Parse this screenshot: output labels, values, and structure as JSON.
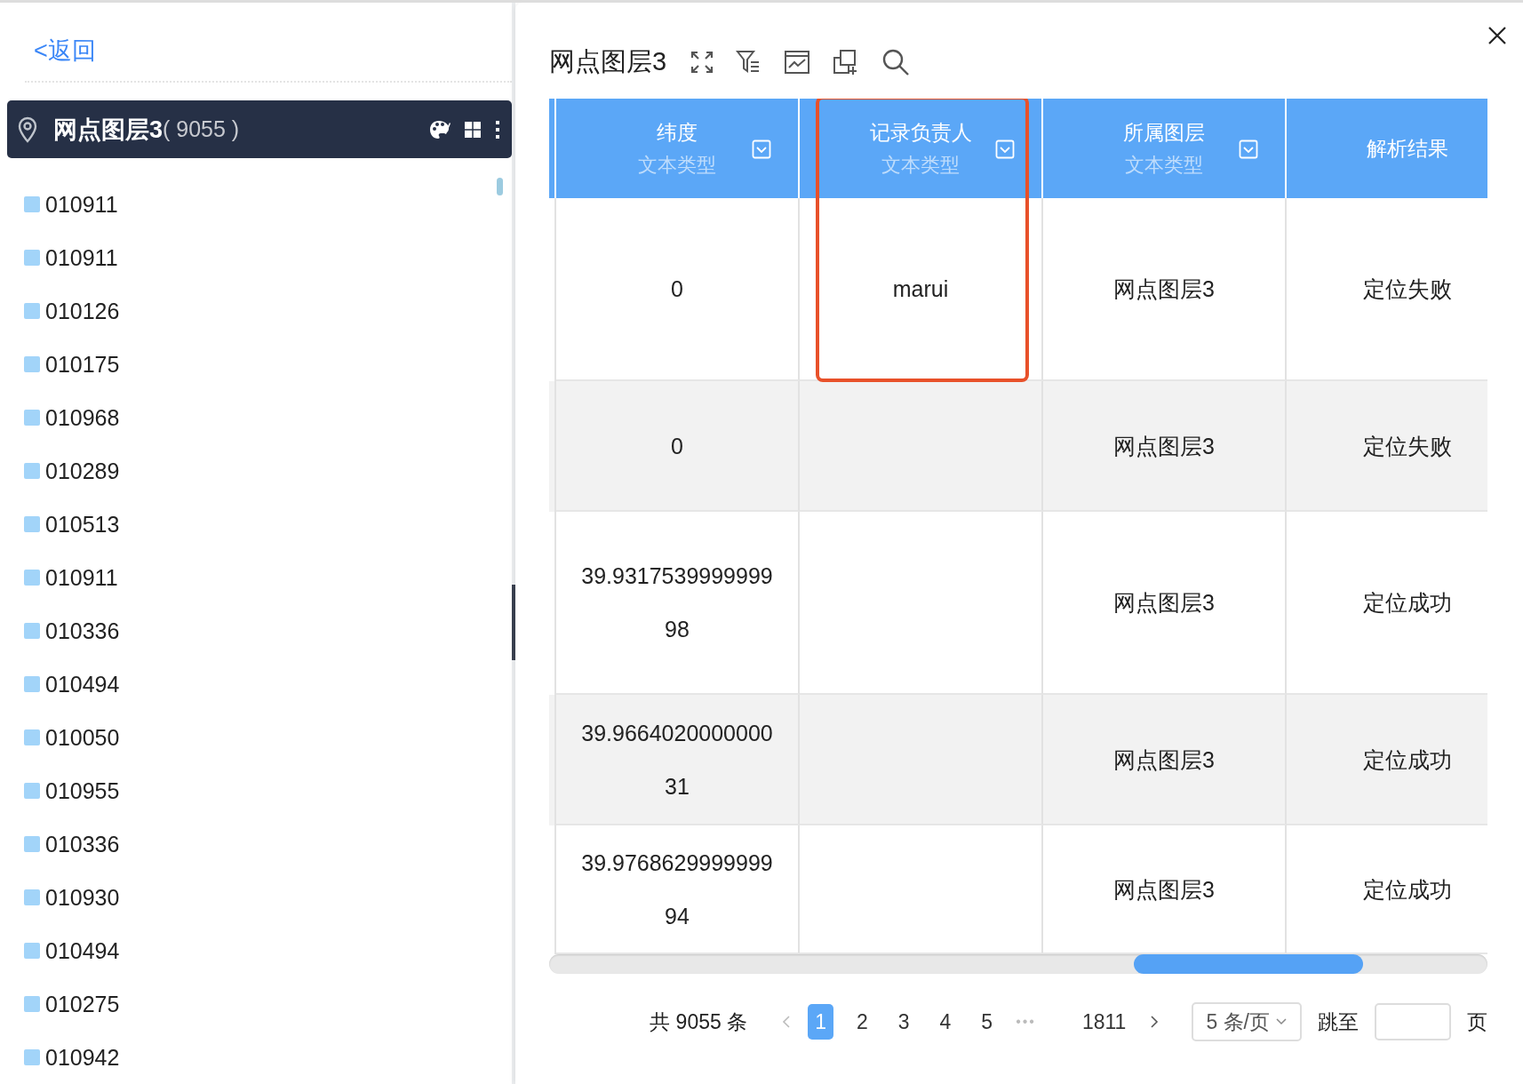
{
  "back_link": "<返回",
  "layer": {
    "name": "网点图层3",
    "count": "( 9055 )"
  },
  "items": [
    "010911",
    "010911",
    "010126",
    "010175",
    "010968",
    "010289",
    "010513",
    "010911",
    "010336",
    "010494",
    "010050",
    "010955",
    "010336",
    "010930",
    "010494",
    "010275",
    "010942"
  ],
  "panel": {
    "title": "网点图层3"
  },
  "columns": [
    {
      "title": "纬度",
      "type": "文本类型",
      "highlighted": false
    },
    {
      "title": "记录负责人",
      "type": "文本类型",
      "highlighted": true
    },
    {
      "title": "所属图层",
      "type": "文本类型",
      "highlighted": false
    },
    {
      "title": "解析结果",
      "highlighted": false
    }
  ],
  "rows": [
    [
      "0",
      "marui",
      "网点图层3",
      "定位失败"
    ],
    [
      "0",
      "",
      "网点图层3",
      "定位失败"
    ],
    [
      "39.931753999999998",
      "",
      "网点图层3",
      "定位成功"
    ],
    [
      "39.966402000000031",
      "",
      "网点图层3",
      "定位成功"
    ],
    [
      "39.976862999999994",
      "",
      "网点图层3",
      "定位成功"
    ]
  ],
  "pagination": {
    "total": "共 9055 条",
    "pages": [
      {
        "label": "1",
        "selected": true
      },
      {
        "label": "2",
        "selected": false
      },
      {
        "label": "3",
        "selected": false
      },
      {
        "label": "4",
        "selected": false
      },
      {
        "label": "5",
        "selected": false
      }
    ],
    "ellipsis": "•••",
    "last": "1811",
    "page_size": "5 条/页",
    "jump_label": "跳至",
    "page_unit": "页"
  }
}
